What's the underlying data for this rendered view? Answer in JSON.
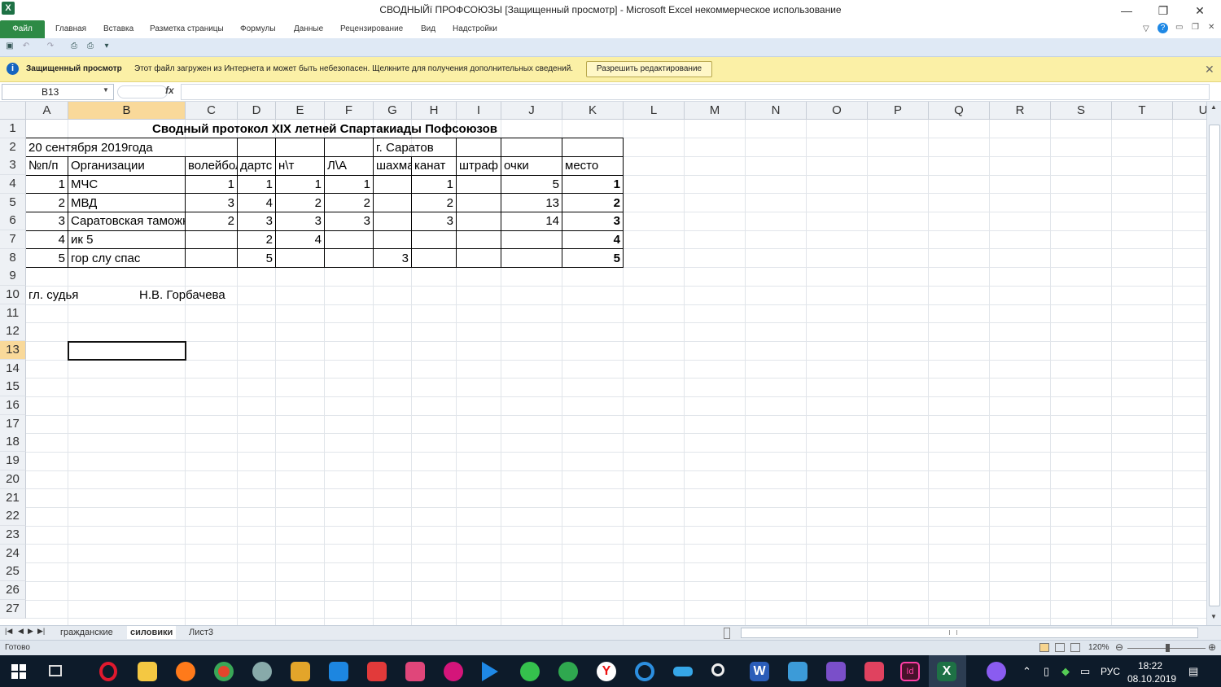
{
  "window": {
    "title": "СВОДНЫЙї ПРОФСОЮЗЫ  [Защищенный просмотр] - Microsoft Excel некоммерческое использование",
    "app_icon": "X",
    "minimize": "—",
    "restore": "❐",
    "close": "✕"
  },
  "ribbon": {
    "file": "Файл",
    "tabs": [
      "Главная",
      "Вставка",
      "Разметка страницы",
      "Формулы",
      "Данные",
      "Рецензирование",
      "Вид",
      "Надстройки"
    ]
  },
  "message_bar": {
    "title": "Защищенный просмотр",
    "text": "Этот файл загружен из Интернета и может быть небезопасен. Щелкните для получения дополнительных сведений.",
    "button": "Разрешить редактирование",
    "close": "✕"
  },
  "formula_bar": {
    "name_box": "B13",
    "fx": "fx",
    "formula": ""
  },
  "columns": [
    "A",
    "B",
    "C",
    "D",
    "E",
    "F",
    "G",
    "H",
    "I",
    "J",
    "K",
    "L",
    "M",
    "N",
    "O",
    "P",
    "Q",
    "R",
    "S",
    "T",
    "U"
  ],
  "selected_column": "B",
  "rows": [
    "1",
    "2",
    "3",
    "4",
    "5",
    "6",
    "7",
    "8",
    "9",
    "10",
    "11",
    "12",
    "13",
    "14",
    "15",
    "16",
    "17",
    "18",
    "19",
    "20",
    "21",
    "22",
    "23",
    "24",
    "25",
    "26",
    "27"
  ],
  "selected_row": "13",
  "sheet": {
    "title": "Сводный протокол XIX летней  Спартакиады Пофсоюзов",
    "date": "20 сентября 2019года",
    "city": "г. Саратов",
    "headers": {
      "A": "№п/п",
      "B": "Организации",
      "C": "волейбол",
      "D": "дартс",
      "E": "н\\т",
      "F": "Л\\А",
      "G": "шахматы",
      "H": "канат",
      "I": "штраф",
      "J": "очки",
      "K": "место"
    },
    "data": [
      {
        "A": "1",
        "B": "МЧС",
        "C": "1",
        "D": "1",
        "E": "1",
        "F": "1",
        "G": "",
        "H": "1",
        "I": "",
        "J": "5",
        "K": "1"
      },
      {
        "A": "2",
        "B": "МВД",
        "C": "3",
        "D": "4",
        "E": "2",
        "F": "2",
        "G": "",
        "H": "2",
        "I": "",
        "J": "13",
        "K": "2"
      },
      {
        "A": "3",
        "B": "Саратовская таможня",
        "C": "2",
        "D": "3",
        "E": "3",
        "F": "3",
        "G": "",
        "H": "3",
        "I": "",
        "J": "14",
        "K": "3"
      },
      {
        "A": "4",
        "B": "ик 5",
        "C": "",
        "D": "2",
        "E": "4",
        "F": "",
        "G": "",
        "H": "",
        "I": "",
        "J": "",
        "K": "4"
      },
      {
        "A": "5",
        "B": "гор слу спас",
        "C": "",
        "D": "5",
        "E": "",
        "F": "",
        "G": "3",
        "H": "",
        "I": "",
        "J": "",
        "K": "5"
      }
    ],
    "judge_label": "гл. судья",
    "judge_name": "Н.В. Горбачева"
  },
  "sheet_tabs": [
    "гражданские",
    "силовики",
    "Лист3"
  ],
  "active_sheet": "силовики",
  "status": {
    "ready": "Готово",
    "zoom": "120%"
  },
  "taskbar": {
    "lang": "РУС",
    "time": "18:22",
    "date": "08.10.2019",
    "icons": [
      "windows-start-icon",
      "task-view-icon",
      "opera-icon",
      "explorer-icon",
      "firefox-icon",
      "chrome-icon",
      "app-icon",
      "paint-icon",
      "teamviewer-icon",
      "app-icon-2",
      "app-icon-3",
      "lg-icon",
      "play-icon",
      "whatsapp-icon",
      "maps-icon",
      "yandex-icon",
      "edge-icon",
      "app-icon-4",
      "search-icon",
      "word-icon",
      "app-icon-5",
      "viber-icon",
      "pdf-icon",
      "indesign-icon",
      "excel-icon",
      "app-icon-6"
    ]
  }
}
